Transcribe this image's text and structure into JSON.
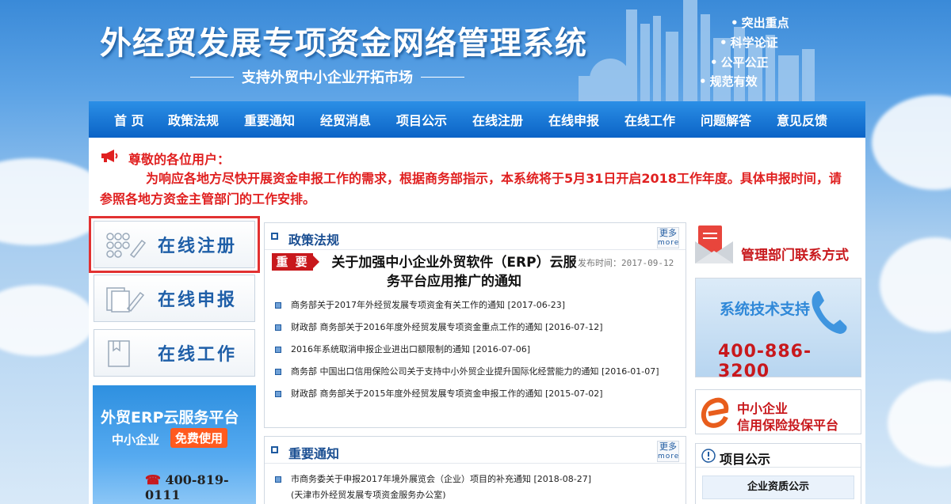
{
  "header": {
    "title": "外经贸发展专项资金网络管理系统",
    "subtitle": "支持外贸中小企业开拓市场",
    "slogans": [
      "突出重点",
      "科学论证",
      "公平公正",
      "规范有效"
    ]
  },
  "nav": {
    "items": [
      "首 页",
      "政策法规",
      "重要通知",
      "经贸消息",
      "项目公示",
      "在线注册",
      "在线申报",
      "在线工作",
      "问题解答",
      "意见反馈"
    ]
  },
  "notice": {
    "greeting": "尊敬的各位用户：",
    "body": "为响应各地方尽快开展资金申报工作的需求，根据商务部指示，本系统将于5月31日开启2018工作年度。具体申报时间，请参照各地方资金主管部门的工作安排。"
  },
  "quick_links": [
    {
      "label": "在线注册",
      "icon": "register-icon",
      "selected": true
    },
    {
      "label": "在线申报",
      "icon": "declare-icon",
      "selected": false
    },
    {
      "label": "在线工作",
      "icon": "work-icon",
      "selected": false
    }
  ],
  "erp_banner": {
    "title": "外贸ERP云服务平台",
    "line2": "中小企业",
    "badge": "免费使用",
    "phone": "400-819-0111"
  },
  "policy_panel": {
    "title": "政策法规",
    "more_cn": "更多",
    "more_en": "more",
    "featured": {
      "badge": "重 要",
      "title": "关于加强中小企业外贸软件（ERP）云服务平台应用推广的通知",
      "date": "发布时间：2017-09-12"
    },
    "items": [
      "商务部关于2017年外经贸发展专项资金有关工作的通知 [2017-06-23]",
      "财政部 商务部关于2016年度外经贸发展专项资金重点工作的通知 [2016-07-12]",
      "2016年系统取消申报企业进出口额限制的通知 [2016-07-06]",
      "商务部 中国出口信用保险公司关于支持中小外贸企业提升国际化经营能力的通知 [2016-01-07]",
      "财政部 商务部关于2015年度外经贸发展专项资金申报工作的通知 [2015-07-02]"
    ]
  },
  "notice_panel": {
    "title": "重要通知",
    "more_cn": "更多",
    "more_en": "more",
    "items": [
      "市商务委关于申报2017年境外展览会（企业）项目的补充通知 [2018-08-27]",
      "(天津市外经贸发展专项资金服务办公室)"
    ]
  },
  "right": {
    "contact": "管理部门联系方式",
    "support_title": "系统技术支持",
    "support_phone": "400-886-3200",
    "credit_line1": "中小企业",
    "credit_line2": "信用保险投保平台",
    "project_title": "项目公示",
    "project_sub": "企业资质公示"
  },
  "colors": {
    "nav_blue": "#0b63c6",
    "notice_red": "#e02020",
    "accent_red": "#c8181c",
    "title_blue": "#1b4f92"
  }
}
